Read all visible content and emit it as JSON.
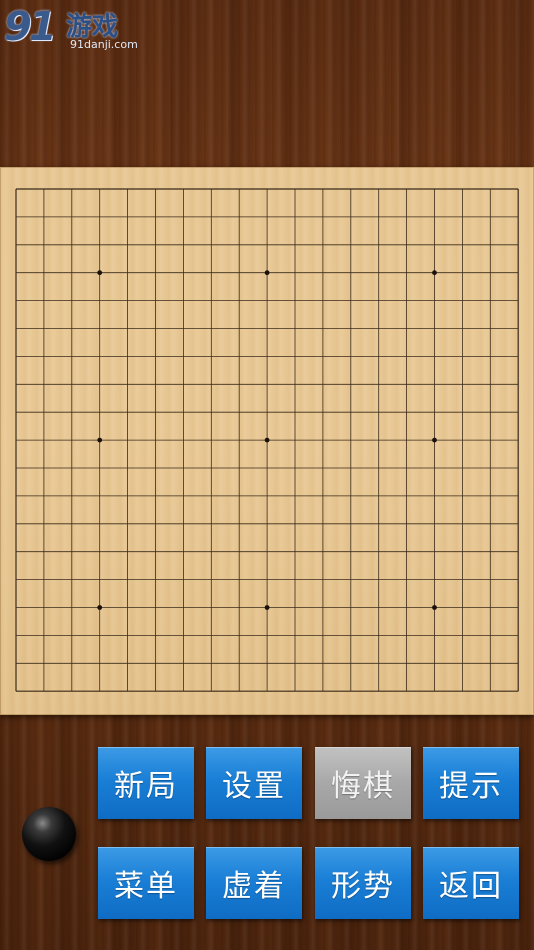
{
  "logo": {
    "number": "91",
    "name": "游戏",
    "url": "91danji.com"
  },
  "board": {
    "size": 19,
    "star_points": [
      [
        3,
        3
      ],
      [
        3,
        9
      ],
      [
        3,
        15
      ],
      [
        9,
        3
      ],
      [
        9,
        9
      ],
      [
        9,
        15
      ],
      [
        15,
        3
      ],
      [
        15,
        9
      ],
      [
        15,
        15
      ]
    ],
    "colors": {
      "line": "#3a2a18",
      "board": "#e8c894"
    }
  },
  "turn_indicator": {
    "color": "black"
  },
  "buttons": {
    "new_game": "新局",
    "settings": "设置",
    "undo": "悔棋",
    "hint": "提示",
    "menu": "菜单",
    "virtual_move": "虚着",
    "situation": "形势",
    "back": "返回"
  },
  "colors": {
    "button": "#1a7fd6",
    "button_disabled": "#a8a8a8"
  }
}
